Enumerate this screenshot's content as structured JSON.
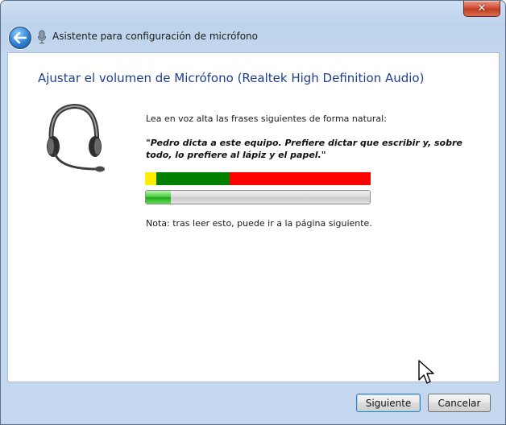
{
  "window": {
    "title": "Asistente para configuración de micrófono",
    "close_symbol": "✕",
    "icons": {
      "back": "back-arrow-icon",
      "app": "microphone-icon",
      "close": "close-icon"
    }
  },
  "content": {
    "heading": "Ajustar el volumen de Micrófono (Realtek High Definition Audio)",
    "instruction": "Lea en voz alta las frases siguientes de forma natural:",
    "quote": "\"Pedro dicta a este equipo. Prefiere dictar que escribir y, sobre todo, lo prefiere al lápiz y el papel.\"",
    "note": "Nota: tras leer esto, puede ir a la página siguiente.",
    "illustration": "headset-icon"
  },
  "level_meter": {
    "segments": [
      {
        "color": "#ffee00",
        "fraction": 0.05
      },
      {
        "color": "#008000",
        "fraction": 0.325
      },
      {
        "color": "#ff0000",
        "fraction": 0.625
      }
    ],
    "current_level_fraction": 0.11,
    "fill_color": "#2fbf2a"
  },
  "buttons": {
    "next": "Siguiente",
    "cancel": "Cancelar"
  }
}
